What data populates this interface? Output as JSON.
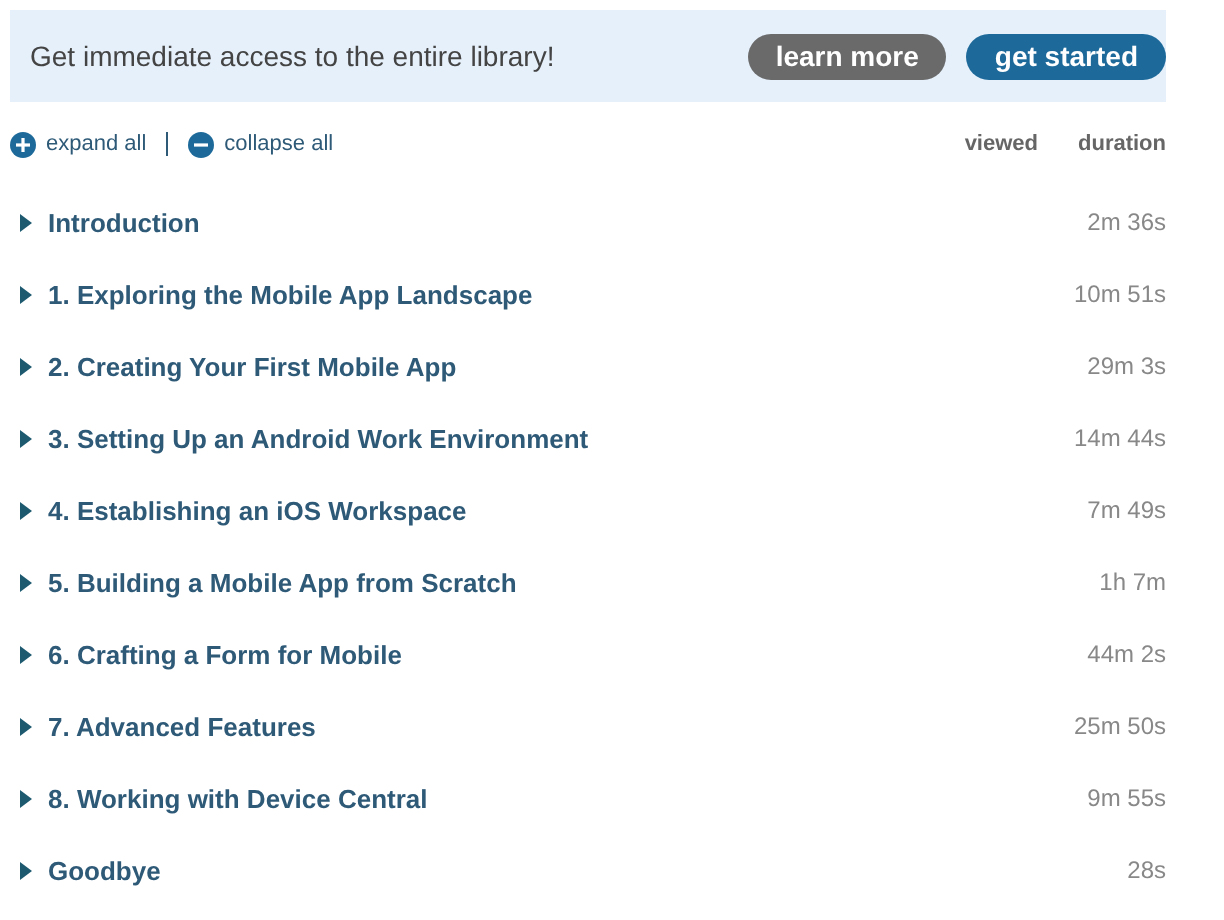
{
  "banner": {
    "message": "Get immediate access to the entire library!",
    "buttons": [
      {
        "label": "learn more",
        "kind": "secondary"
      },
      {
        "label": "get started",
        "kind": "primary"
      }
    ]
  },
  "toolbar": {
    "expand_all": "expand all",
    "collapse_all": "collapse all",
    "columns": [
      "viewed",
      "duration"
    ]
  },
  "chapters": [
    {
      "title": "Introduction",
      "duration": "2m 36s",
      "expanded": false
    },
    {
      "title": "1. Exploring the Mobile App Landscape",
      "duration": "10m 51s",
      "expanded": false
    },
    {
      "title": "2. Creating Your First Mobile App",
      "duration": "29m 3s",
      "expanded": false
    },
    {
      "title": "3. Setting Up an Android Work Environment",
      "duration": "14m 44s",
      "expanded": false
    },
    {
      "title": "4. Establishing an iOS Workspace",
      "duration": "7m 49s",
      "expanded": false
    },
    {
      "title": "5. Building a Mobile App from Scratch",
      "duration": "1h 7m",
      "expanded": false
    },
    {
      "title": "6. Crafting a Form for Mobile",
      "duration": "44m 2s",
      "expanded": false
    },
    {
      "title": "7. Advanced Features",
      "duration": "25m 50s",
      "expanded": false
    },
    {
      "title": "8. Working with Device Central",
      "duration": "9m 55s",
      "expanded": false
    },
    {
      "title": "Goodbye",
      "duration": "28s",
      "expanded": false
    }
  ]
}
